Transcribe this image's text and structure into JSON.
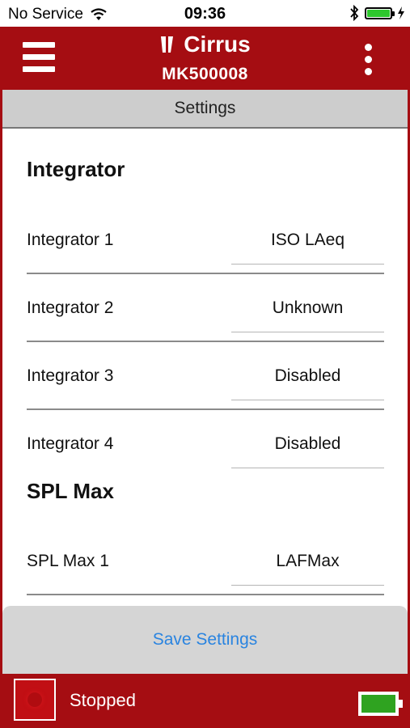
{
  "status_bar": {
    "carrier": "No Service",
    "time": "09:36",
    "battery_level": 1.0
  },
  "header": {
    "logo_text": "Cirrus",
    "device_id": "MK500008"
  },
  "settings_bar": {
    "title": "Settings"
  },
  "sections": {
    "integrator": {
      "title": "Integrator",
      "rows": [
        {
          "label": "Integrator 1",
          "value": "ISO LAeq"
        },
        {
          "label": "Integrator 2",
          "value": "Unknown"
        },
        {
          "label": "Integrator 3",
          "value": "Disabled"
        },
        {
          "label": "Integrator 4",
          "value": "Disabled"
        }
      ]
    },
    "spl_max": {
      "title": "SPL Max",
      "rows": [
        {
          "label": "SPL Max 1",
          "value": "LAFMax"
        }
      ]
    }
  },
  "actions": {
    "save_label": "Save Settings"
  },
  "footer": {
    "status": "Stopped",
    "device_battery_level": 1.0
  },
  "colors": {
    "brand_red": "#a50d12",
    "link_blue": "#2a84e0",
    "battery_green": "#2fa320"
  },
  "icons": [
    "wifi-icon",
    "bluetooth-icon",
    "charging-icon",
    "menu-icon",
    "more-options-icon",
    "record-icon",
    "battery-icon"
  ]
}
